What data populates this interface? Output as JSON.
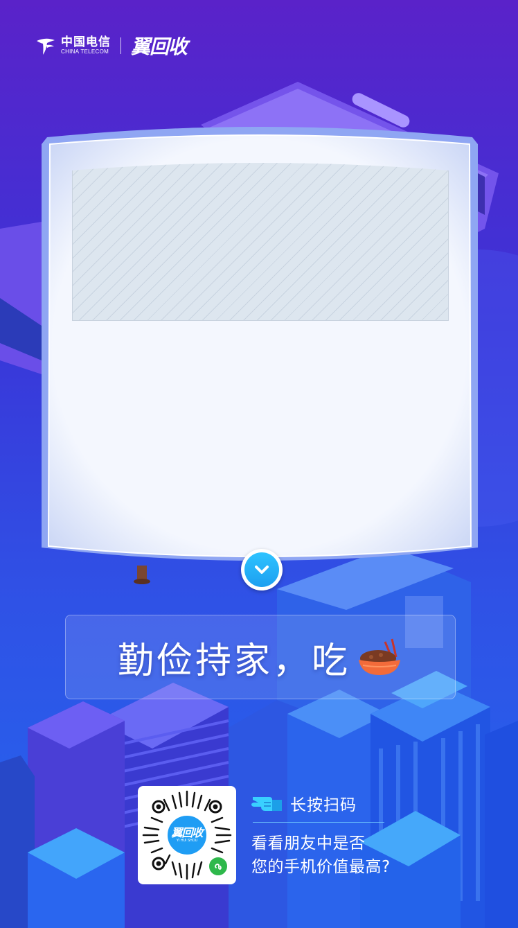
{
  "header": {
    "telecom_name_cn": "中国电信",
    "telecom_name_en": "CHINA TELECOM",
    "service_logo_text": "翼回收"
  },
  "main": {
    "slogan": "勤俭持家，吃",
    "expand_icon": "chevron-down-icon",
    "food_icon": "noodle-bowl-icon"
  },
  "footer": {
    "qr_logo_text": "翼回收",
    "qr_logo_subtext": "YI HUI SHOU",
    "scan_label": "长按扫码",
    "desc_line1": "看看朋友中是否",
    "desc_line2": "您的手机价值最高?"
  },
  "colors": {
    "bg_top": "#5a22c9",
    "bg_bottom": "#2366ee",
    "accent_cyan": "#2ec3ff",
    "card_bg": "#f2f6fd",
    "bowl": "#f26b3a",
    "miniprogram_green": "#2eb84b"
  }
}
